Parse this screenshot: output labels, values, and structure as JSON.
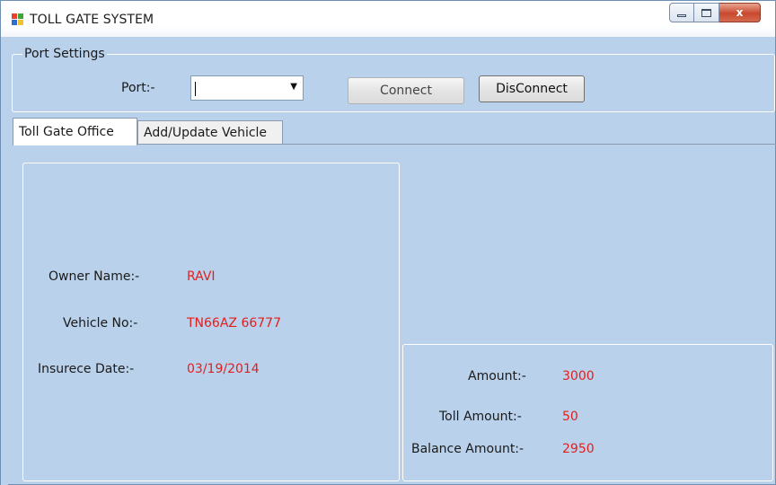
{
  "window": {
    "title": "TOLL GATE SYSTEM",
    "icon": "windows-forms-app-icon",
    "controls": {
      "minimize": "minimize-icon",
      "maximize": "maximize-icon",
      "close": "x"
    }
  },
  "port_settings": {
    "legend": "Port Settings",
    "port_label": "Port:-",
    "port_value": "",
    "connect_label": "Connect",
    "disconnect_label": "DisConnect"
  },
  "tabs": [
    {
      "label": "Toll Gate Office",
      "active": true
    },
    {
      "label": "Add/Update Vehicle",
      "active": false
    }
  ],
  "vehicle": {
    "owner_label": "Owner Name:-",
    "owner_value": "RAVI",
    "vehicle_label": "Vehicle No:-",
    "vehicle_value": "TN66AZ 66777",
    "insurance_label": "Insurece Date:-",
    "insurance_value": "03/19/2014"
  },
  "payment": {
    "amount_label": "Amount:-",
    "amount_value": "3000",
    "toll_label": "Toll Amount:-",
    "toll_value": "50",
    "balance_label": "Balance Amount:-",
    "balance_value": "2950"
  },
  "colors": {
    "form_background": "#b9d1ea",
    "value_text": "#e02020"
  }
}
